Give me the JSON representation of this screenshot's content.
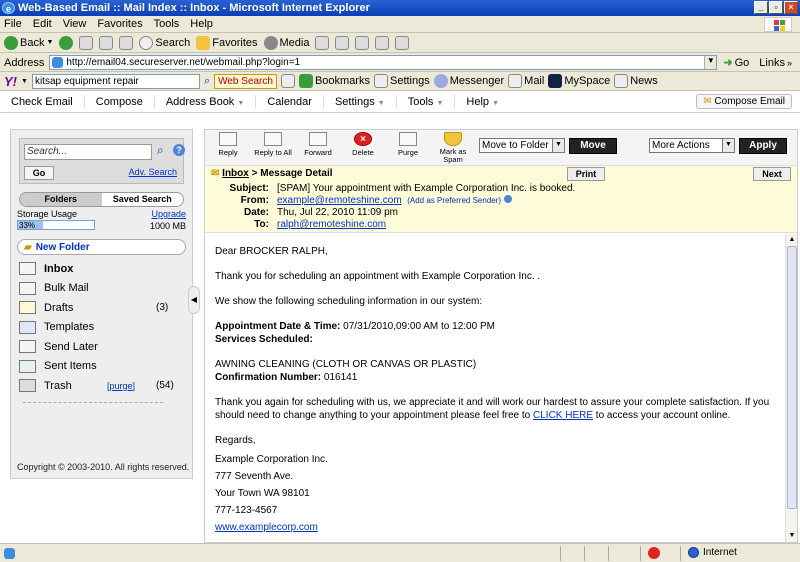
{
  "window": {
    "title": "Web-Based Email :: Mail Index :: Inbox - Microsoft Internet Explorer",
    "controls": [
      "_",
      "▫",
      "×"
    ]
  },
  "menu": [
    "File",
    "Edit",
    "View",
    "Favorites",
    "Tools",
    "Help"
  ],
  "toolbar": {
    "back": "Back",
    "search": "Search",
    "favorites": "Favorites",
    "media": "Media"
  },
  "address": {
    "label": "Address",
    "url": "http://email04.secureserver.net/webmail.php?login=1",
    "go": "Go",
    "links": "Links"
  },
  "yahoo": {
    "search_value": "kitsap equipment repair",
    "search_button": "Web Search",
    "bookmarks": "Bookmarks",
    "settings": "Settings",
    "messenger": "Messenger",
    "mail": "Mail",
    "myspace": "MySpace",
    "news": "News"
  },
  "appnav": {
    "items": [
      "Check Email",
      "Compose",
      "Address Book",
      "Calendar",
      "Settings",
      "Tools",
      "Help"
    ],
    "compose_mail": "Compose Email"
  },
  "sidebar": {
    "search_placeholder": "Search...",
    "go": "Go",
    "adv_search": "Adv. Search",
    "tab_folders": "Folders",
    "tab_saved": "Saved Search",
    "storage_label": "Storage Usage",
    "storage_percent": "33%",
    "storage_fraction": 0.33,
    "upgrade": "Upgrade",
    "storage_total": "1000 MB",
    "new_folder": "New Folder",
    "folders": [
      {
        "name": "Inbox",
        "count": "",
        "bold": true
      },
      {
        "name": "Bulk Mail",
        "count": ""
      },
      {
        "name": "Drafts",
        "count": "(3)"
      },
      {
        "name": "Templates",
        "count": ""
      },
      {
        "name": "Send Later",
        "count": ""
      },
      {
        "name": "Sent Items",
        "count": ""
      },
      {
        "name": "Trash",
        "count": "(54)",
        "purge": "[purge]"
      }
    ],
    "copyright": "Copyright © 2003-2010. All rights reserved."
  },
  "actions": {
    "reply": "Reply",
    "reply_all": "Reply to All",
    "forward": "Forward",
    "delete": "Delete",
    "purge": "Purge",
    "mark_spam_1": "Mark as",
    "mark_spam_2": "Spam",
    "move_select": "Move to Folder",
    "move_button": "Move",
    "more_select": "More Actions",
    "apply_button": "Apply"
  },
  "detail": {
    "crumb_inbox": "Inbox",
    "crumb_rest": " > Message Detail",
    "print": "Print",
    "next": "Next",
    "subject_label": "Subject:",
    "subject": "[SPAM] Your appointment with Example Corporation Inc. is booked.",
    "from_label": "From:",
    "from": "example@remoteshine.com",
    "preferred": "(Add as Preferred Sender)",
    "date_label": "Date:",
    "date": "Thu, Jul 22, 2010 11:09 pm",
    "to_label": "To:",
    "to": "ralph@remoteshine.com"
  },
  "body": {
    "greeting": "Dear BROCKER RALPH,",
    "thanks": "Thank you for scheduling an appointment with Example Corporation Inc. .",
    "show": "We show the following scheduling information in our system:",
    "appt_label": "Appointment Date & Time:",
    "appt_value": " 07/31/2010,09:00 AM to 12:00 PM",
    "services_label": "Services Scheduled:",
    "service": "AWNING CLEANING (CLOTH OR CANVAS OR PLASTIC)",
    "confirm_label": "Confirmation Number:",
    "confirm_value": " 016141",
    "closing_1": "Thank you again for scheduling with us, we appreciate it and will work our hardest to assure your complete satisfaction. If you should need to change anything to your appointment please feel free to ",
    "click_here": "CLICK HERE",
    "closing_2": " to access your account online.",
    "regards": "Regards,",
    "company": "Example Corporation Inc.",
    "street": "777 Seventh Ave.",
    "city": "Your Town WA 98101",
    "phone": "777-123-4567",
    "website": "www.examplecorp.com"
  },
  "status": {
    "zone": "Internet"
  }
}
